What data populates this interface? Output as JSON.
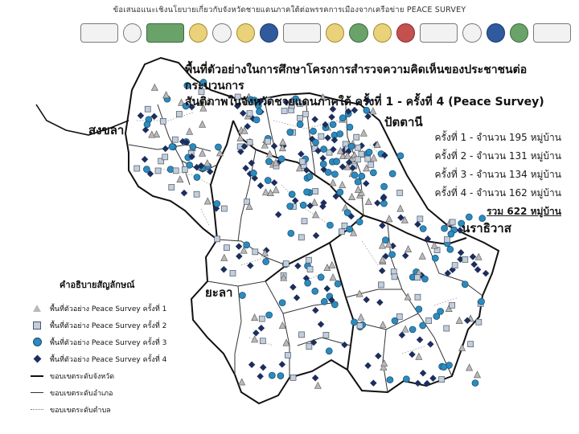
{
  "header": {
    "title": "ข้อเสนอแนะเชิงนโยบายเกี่ยวกับจังหวัดชายแดนภาคใต้ต่อพรรคการเมืองจากเครือข่าย PEACE SURVEY"
  },
  "logos": [
    "logo",
    "logo",
    "logo",
    "logo",
    "logo",
    "logo",
    "logo",
    "logo",
    "logo",
    "logo",
    "logo",
    "logo",
    "logo",
    "logo",
    "logo",
    "logo",
    "logo"
  ],
  "map": {
    "title_line1": "พื้นที่ตัวอย่างในการศึกษาโครงการสำรวจความคิดเห็นของประชาชนต่อกระบวนการ",
    "title_line2": "สันติภาพในจังหวัดชายแดนภาคใต้ ครั้งที่ 1 - ครั้งที่ 4 (Peace Survey)",
    "provinces": {
      "songkhla": "สงขลา",
      "pattani": "ปัตตานี",
      "narathiwat": "นราธิวาส",
      "yala": "ยะลา"
    },
    "stats": [
      "ครั้งที่ 1 - จำนวน 195 หมู่บ้าน",
      "ครั้งที่ 2 - จำนวน 131 หมู่บ้าน",
      "ครั้งที่ 3 - จำนวน 134 หมู่บ้าน",
      "ครั้งที่ 4 - จำนวน 162 หมู่บ้าน"
    ],
    "total": "รวม 622 หมู่บ้าน",
    "colors": {
      "land": "#ffffff",
      "round1": "#b9b9b9",
      "round2": "#c3cedb",
      "round3": "#2b8bc0",
      "round4": "#1c2e5c",
      "border": "#111111"
    }
  },
  "legend": {
    "title": "คำอธิบายสัญลักษณ์",
    "items": [
      "พื้นที่ตัวอย่าง Peace Survey ครั้งที่ 1",
      "พื้นที่ตัวอย่าง Peace Survey ครั้งที่ 2",
      "พื้นที่ตัวอย่าง Peace Survey ครั้งที่ 3",
      "พื้นที่ตัวอย่าง Peace Survey ครั้งที่ 4",
      "ขอบเขตระดับจังหวัด",
      "ขอบเขตระดับอำเภอ",
      "ขอบเขตระดับตำบล"
    ]
  }
}
